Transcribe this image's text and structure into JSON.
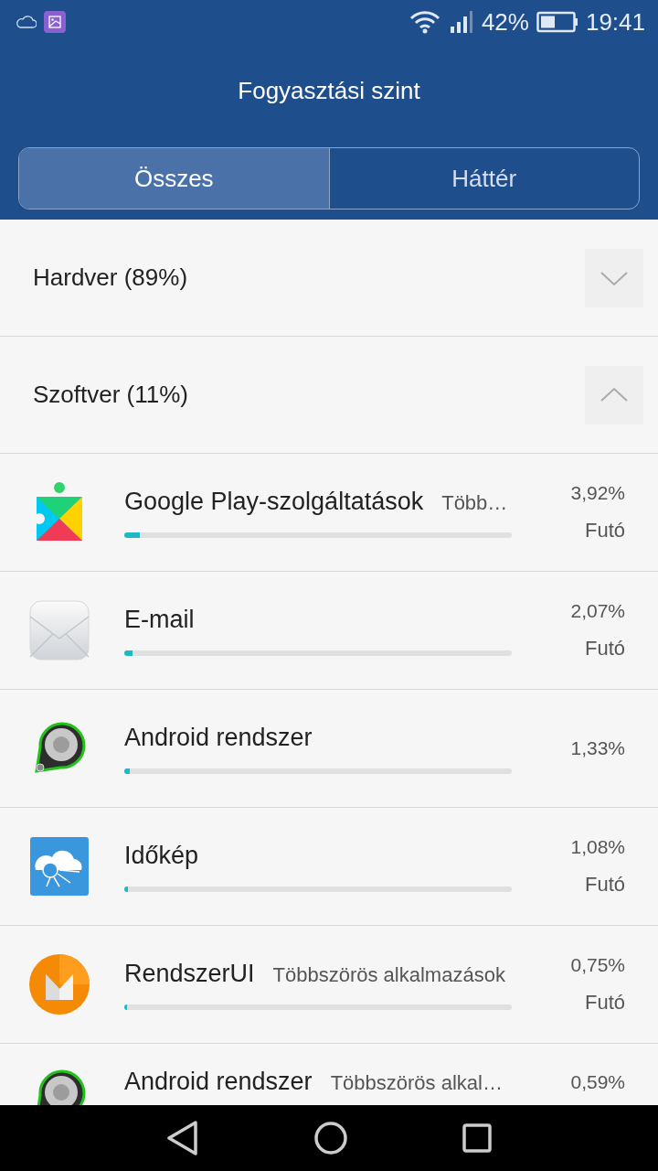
{
  "status_bar": {
    "battery_percent": "42%",
    "time": "19:41"
  },
  "window": {
    "title": "Fogyasztási szint"
  },
  "tabs": [
    {
      "label": "Összes",
      "selected": true
    },
    {
      "label": "Háttér",
      "selected": false
    }
  ],
  "sections": [
    {
      "label": "Hardver (89%)",
      "expanded": false
    },
    {
      "label": "Szoftver (11%)",
      "expanded": true
    }
  ],
  "apps": [
    {
      "kind": "play",
      "name": "Google Play-szolgáltatások",
      "subtitle": "Több…",
      "percent": "3,92%",
      "status": "Futó",
      "level": 0.04
    },
    {
      "kind": "mail",
      "name": "E-mail",
      "percent": "2,07%",
      "status": "Futó",
      "level": 0.022
    },
    {
      "kind": "android",
      "name": "Android rendszer",
      "percent": "1,33%",
      "level": 0.013
    },
    {
      "kind": "weather",
      "name": "Időkép",
      "percent": "1,08%",
      "status": "Futó",
      "level": 0.01
    },
    {
      "kind": "m",
      "name": "RendszerUI",
      "subtitle": "Többszörös alkalmazások",
      "percent": "0,75%",
      "status": "Futó",
      "level": 0.008
    },
    {
      "kind": "android",
      "name": "Android rendszer",
      "subtitle": "Többszörös alkal…",
      "percent": "0,59%"
    }
  ]
}
